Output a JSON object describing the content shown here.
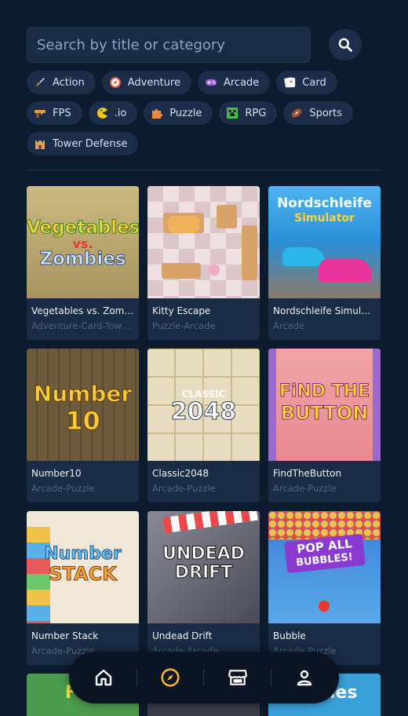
{
  "search": {
    "placeholder": "Search by title or category",
    "button_icon": "search-icon"
  },
  "categories": [
    {
      "label": "Action",
      "icon": "sword-icon",
      "color": "#f3c74c"
    },
    {
      "label": "Adventure",
      "icon": "compass-icon",
      "color": "#e2563c"
    },
    {
      "label": "Arcade",
      "icon": "gamepad-icon",
      "color": "#a05ce6"
    },
    {
      "label": "Card",
      "icon": "cards-icon",
      "color": "#e45a5a"
    },
    {
      "label": "FPS",
      "icon": "gun-icon",
      "color": "#e3a036"
    },
    {
      "label": ".io",
      "icon": "pacman-icon",
      "color": "#f5c518"
    },
    {
      "label": "Puzzle",
      "icon": "puzzle-icon",
      "color": "#f08a3c"
    },
    {
      "label": "RPG",
      "icon": "creeper-icon",
      "color": "#3fbf4a"
    },
    {
      "label": "Sports",
      "icon": "football-icon",
      "color": "#a0522d"
    },
    {
      "label": "Tower Defense",
      "icon": "castle-icon",
      "color": "#d8a05a"
    }
  ],
  "games": [
    {
      "title": "Vegetables vs. Zombies",
      "category": "Adventure-Card-Tower Defense",
      "art_lines": [
        "Vegetables",
        "vs.",
        "Zombies"
      ],
      "bg": "#c9b57a"
    },
    {
      "title": "Kitty Escape",
      "category": "Puzzle-Arcade",
      "art_lines": [],
      "bg": "#ead7d7"
    },
    {
      "title": "Nordschleife Simulator",
      "category": "Arcade",
      "art_lines": [
        "Nordschleife",
        "Simulator"
      ],
      "bg": "#2b8fd6"
    },
    {
      "title": "Number10",
      "category": "Arcade-Puzzle",
      "art_lines": [
        "Number",
        "10"
      ],
      "bg": "#5a4a32"
    },
    {
      "title": "Classic2048",
      "category": "Arcade-Puzzle",
      "art_lines": [
        "CLASSIC",
        "2048"
      ],
      "bg": "#e8dcc0"
    },
    {
      "title": "FindTheButton",
      "category": "Arcade-Puzzle",
      "art_lines": [
        "FiND THE",
        "BUTTON"
      ],
      "bg": "#b98ed6"
    },
    {
      "title": "Number Stack",
      "category": "Arcade-Puzzle",
      "art_lines": [
        "Number",
        "STACK"
      ],
      "bg": "#f2e8d8"
    },
    {
      "title": "Undead Drift",
      "category": "Arcade-Arcade",
      "art_lines": [
        "UNDEAD",
        "DRIFT"
      ],
      "bg": "#6b6b78"
    },
    {
      "title": "Bubble",
      "category": "Arcade-Puzzle",
      "art_lines": [
        "POP ALL",
        "BUBBLES!"
      ],
      "bg": "#3b7fd6"
    }
  ],
  "partial_games": [
    {
      "art_line": "Fun",
      "bg": "#4c9a4c"
    },
    {
      "art_line": "",
      "bg": "#3a3a48"
    },
    {
      "art_line": "Games",
      "bg": "#3aa0d8"
    }
  ],
  "nav": [
    {
      "name": "home",
      "icon": "home-icon",
      "active": false
    },
    {
      "name": "explore",
      "icon": "compass-icon",
      "active": true
    },
    {
      "name": "store",
      "icon": "store-icon",
      "active": false
    },
    {
      "name": "profile",
      "icon": "user-icon",
      "active": false
    }
  ],
  "colors": {
    "background": "#0d1b2e",
    "card": "#1a2b45",
    "accent": "#f0b429",
    "muted_text": "#4f6483"
  }
}
